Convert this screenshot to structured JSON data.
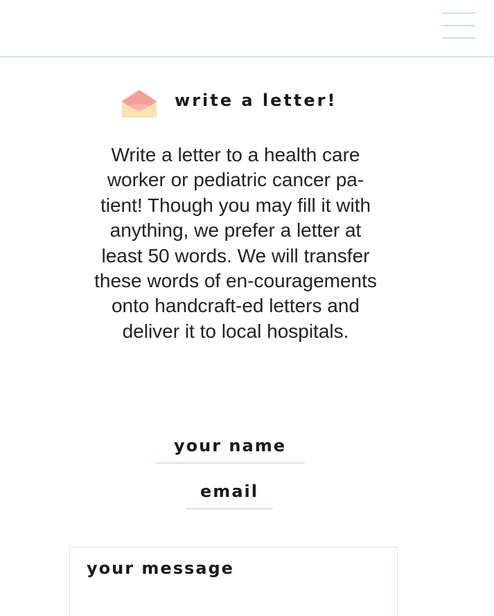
{
  "header": {
    "menu_icon": "hamburger-menu-icon",
    "divider_color": "#cfe8ec"
  },
  "section": {
    "icon": "envelope-icon",
    "title": "write a letter!",
    "description": "Write a letter to a health care worker or pediatric cancer pa-tient! Though you may fill it with anything, we prefer a letter at least 50 words. We will transfer these words of en-couragements onto handcraft-ed letters and deliver it to local hospitals."
  },
  "form": {
    "name_placeholder": "your name",
    "email_placeholder": "email",
    "message_placeholder": "your message"
  },
  "colors": {
    "accent_line": "#cfe8ec",
    "envelope_flap": "#f4a09a",
    "envelope_body": "#f7d79a",
    "text": "#1a1a1a"
  }
}
